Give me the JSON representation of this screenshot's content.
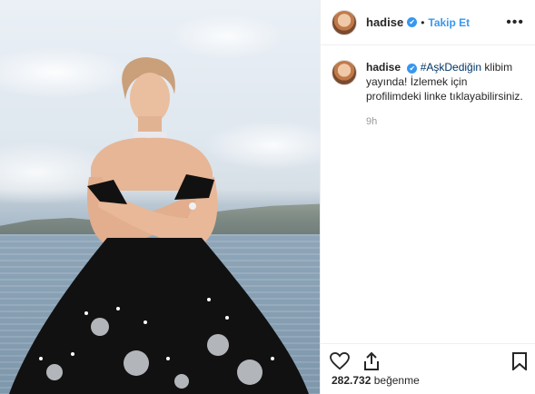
{
  "post": {
    "author": {
      "username": "hadise",
      "verified": true,
      "follow_label": "Takip Et",
      "separator": "•"
    },
    "caption": {
      "username": "hadise",
      "hashtag": "#AşkDediğin",
      "text": "klibim yayında! İzlemek için profilimdeki linke tıklayabilirsiniz."
    },
    "time_ago": "9h",
    "likes_count": "282.732",
    "likes_word": "beğenme"
  },
  "icons": {
    "more": "more-options-icon",
    "verified": "verified-badge-icon",
    "like": "heart-icon",
    "share": "share-icon",
    "save": "bookmark-icon"
  },
  "colors": {
    "link_blue": "#3897f0",
    "hashtag": "#003569",
    "dress": "#111111"
  }
}
